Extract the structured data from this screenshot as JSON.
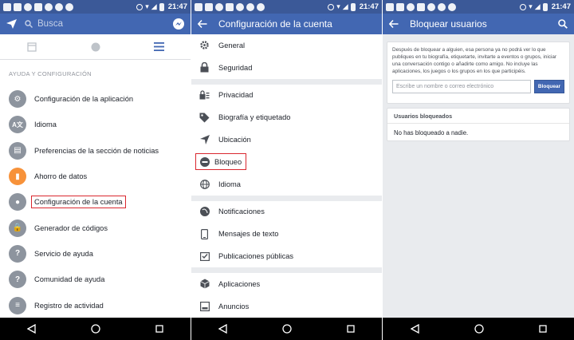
{
  "status": {
    "time": "21:47"
  },
  "screen1": {
    "search_placeholder": "Busca",
    "section_header": "AYUDA Y CONFIGURACIÓN",
    "items": [
      {
        "label": "Configuración de la aplicación",
        "icon": "gear-icon"
      },
      {
        "label": "Idioma",
        "icon": "language-icon"
      },
      {
        "label": "Preferencias de la sección de noticias",
        "icon": "news-feed-icon"
      },
      {
        "label": "Ahorro de datos",
        "icon": "data-saver-icon"
      },
      {
        "label": "Configuración de la cuenta",
        "icon": "account-settings-icon"
      },
      {
        "label": "Generador de códigos",
        "icon": "lock-icon"
      },
      {
        "label": "Servicio de ayuda",
        "icon": "help-icon"
      },
      {
        "label": "Comunidad de ayuda",
        "icon": "help-community-icon"
      },
      {
        "label": "Registro de actividad",
        "icon": "activity-log-icon"
      }
    ]
  },
  "screen2": {
    "title": "Configuración de la cuenta",
    "items": [
      {
        "label": "General",
        "icon": "gear-icon"
      },
      {
        "label": "Seguridad",
        "icon": "lock-icon"
      },
      {
        "label": "Privacidad",
        "icon": "privacy-icon"
      },
      {
        "label": "Biografía y etiquetado",
        "icon": "tag-icon"
      },
      {
        "label": "Ubicación",
        "icon": "location-arrow-icon"
      },
      {
        "label": "Bloqueo",
        "icon": "block-icon"
      },
      {
        "label": "Idioma",
        "icon": "globe-icon"
      },
      {
        "label": "Notificaciones",
        "icon": "globe-icon"
      },
      {
        "label": "Mensajes de texto",
        "icon": "phone-icon"
      },
      {
        "label": "Publicaciones públicas",
        "icon": "public-posts-icon"
      },
      {
        "label": "Aplicaciones",
        "icon": "apps-cube-icon"
      },
      {
        "label": "Anuncios",
        "icon": "ads-icon"
      }
    ]
  },
  "screen3": {
    "title": "Bloquear usuarios",
    "info": "Después de bloquear a alguien, esa persona ya no podrá ver lo que publiques en tu biografía, etiquetarte, invitarte a eventos o grupos, iniciar una conversación contigo o añadirte como amigo. No incluye las aplicaciones, los juegos o los grupos en los que participéis.",
    "input_placeholder": "Escribe un nombre o correo electrónico",
    "block_button": "Bloquear",
    "blocked_header": "Usuarios bloqueados",
    "blocked_empty": "No has bloqueado a nadie."
  },
  "colors": {
    "fb_blue": "#4267b2",
    "status_blue": "#3b5998",
    "highlight_red": "#d9272e",
    "icon_gray": "#8d949e",
    "orange": "#f7923a"
  }
}
